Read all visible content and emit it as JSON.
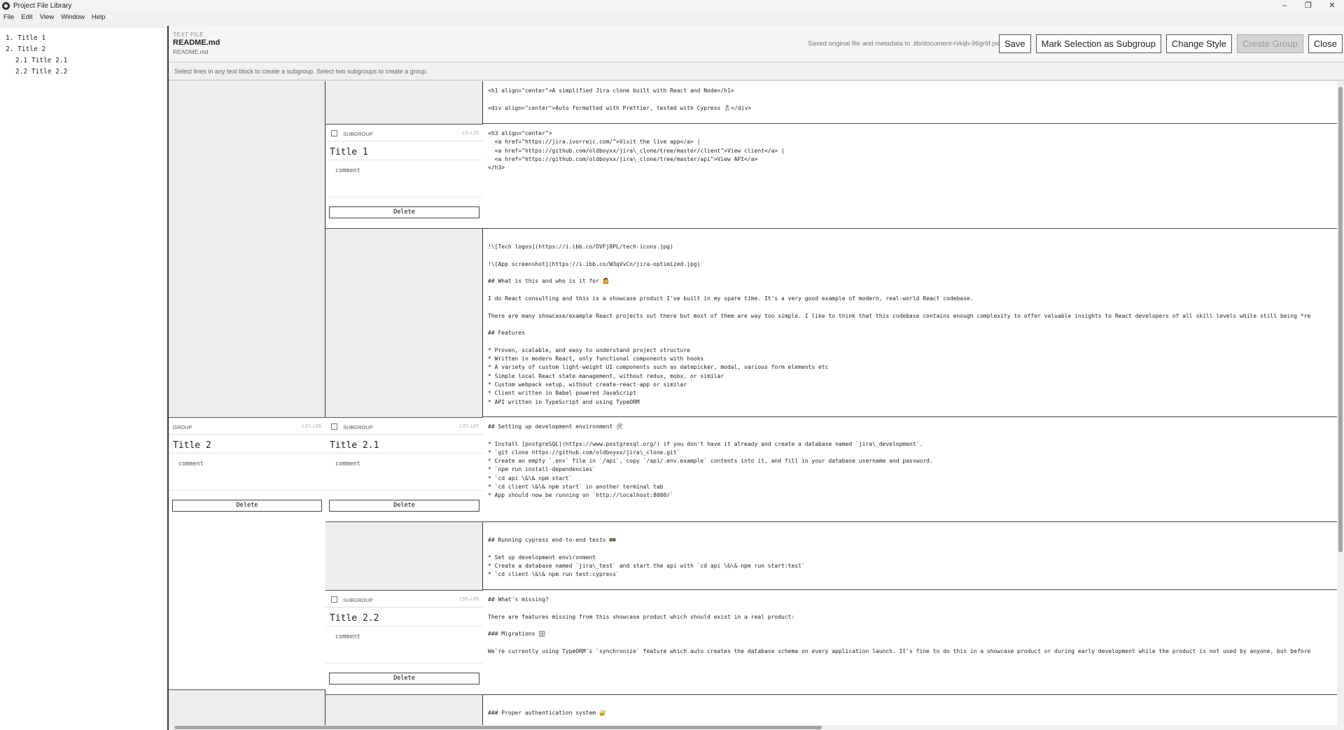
{
  "window": {
    "title": "Project File Library",
    "minimize": "–",
    "restore": "❐",
    "close": "✕"
  },
  "menu": [
    "File",
    "Edit",
    "View",
    "Window",
    "Help"
  ],
  "outline": [
    "1. Title 1",
    "2. Title 2",
    "2.1 Title 2.1",
    "2.2 Title 2.2"
  ],
  "header": {
    "kind": "TEXT FILE",
    "filename": "README.md",
    "subname": "README.md",
    "status": "Saved original file and metadata to .lib/document-rvkijb-96gr6f.json",
    "buttons": {
      "save": "Save",
      "mark": "Mark Selection as Subgroup",
      "style": "Change Style",
      "create": "Create Group",
      "close": "Close"
    }
  },
  "hint": "Select lines in any text block to create a subgroup. Select two subgroups to create a group.",
  "group": {
    "kind": "GROUP",
    "range": "L37–L65",
    "title": "Title 2",
    "comment": "comment",
    "delete": "Delete"
  },
  "subgroups": [
    {
      "kind": "SUBGROUP",
      "range": "L5–L15",
      "title": "Title 1",
      "comment": "comment",
      "delete": "Delete"
    },
    {
      "kind": "SUBGROUP",
      "range": "L37–L47",
      "title": "Title 2.1",
      "comment": "comment",
      "delete": "Delete"
    },
    {
      "kind": "SUBGROUP",
      "range": "L55–L65",
      "title": "Title 2.2",
      "comment": "comment",
      "delete": "Delete"
    }
  ],
  "text_blocks": [
    [
      "<h1 align=\"center\">A simplified Jira clone built with React and Node</h1>",
      "",
      "<div align=\"center\">Auto formatted with Prettier, tested with Cypress 🎗</div>"
    ],
    [
      "<h3 align=\"center\">",
      "  <a href=\"https://jira.ivorreic.com/\">Visit the live app</a> |",
      "  <a href=\"https://github.com/oldboyxx/jira\\_clone/tree/master/client\">View client</a> |",
      "  <a href=\"https://github.com/oldboyxx/jira\\_clone/tree/master/api\">View API</a>",
      "</h3>"
    ],
    [
      "",
      "!\\[Tech logos](https://i.ibb.co/DVFj8PL/tech-icons.jpg)",
      "",
      "!\\[App screenshot](https://i.ibb.co/W3qVvCn/jira-optimized.jpg)",
      "",
      "## What is this and who is it for 🤷",
      "",
      "I do React consulting and this is a showcase product I've built in my spare time. It's a very good example of modern, real-world React codebase.",
      "",
      "There are many showcase/example React projects out there but most of them are way too simple. I like to think that this codebase contains enough complexity to offer valuable insights to React developers of all skill levels while still being *re",
      "",
      "## Features",
      "",
      "* Proven, scalable, and easy to understand project structure",
      "* Written in modern React, only functional components with hooks",
      "* A variety of custom light-weight UI components such as datepicker, modal, various form elements etc",
      "* Simple local React state management, without redux, mobx, or similar",
      "* Custom webpack setup, without create-react-app or similar",
      "* Client written in Babel powered JavaScript",
      "* API written in TypeScript and using TypeORM"
    ],
    [
      "## Setting up development environment 🛠",
      "",
      "* Install [postgreSQL](https://www.postgresql.org/) if you don't have it already and create a database named `jira\\_development`.",
      "* `git clone https://github.com/oldboyxx/jira\\_clone.git`",
      "* Create an empty `.env` file in `/api`, copy `/api/.env.example` contents into it, and fill in your database username and password.",
      "* `npm run install-dependencies`",
      "* `cd api \\&\\& npm start`",
      "* `cd client \\&\\& npm start` in another terminal tab",
      "* App should now be running on `http://localhost:8080/`"
    ],
    [
      "",
      "## Running cypress end-to-end tests 🚥",
      "",
      "* Set up development environment",
      "* Create a database named `jira\\_test` and start the api with `cd api \\&\\& npm run start:test`",
      "* `cd client \\&\\& npm run test:cypress`"
    ],
    [
      "## What's missing?",
      "",
      "There are features missing from this showcase product which should exist in a real product:",
      "",
      "### Migrations 🗄",
      "",
      "We're currently using TypeORM's `synchronize` feature which auto creates the database schema on every application launch. It's fine to do this in a showcase product or during early development while the product is not used by anyone, but before"
    ],
    [
      "",
      "### Proper authentication system 🔐"
    ]
  ]
}
